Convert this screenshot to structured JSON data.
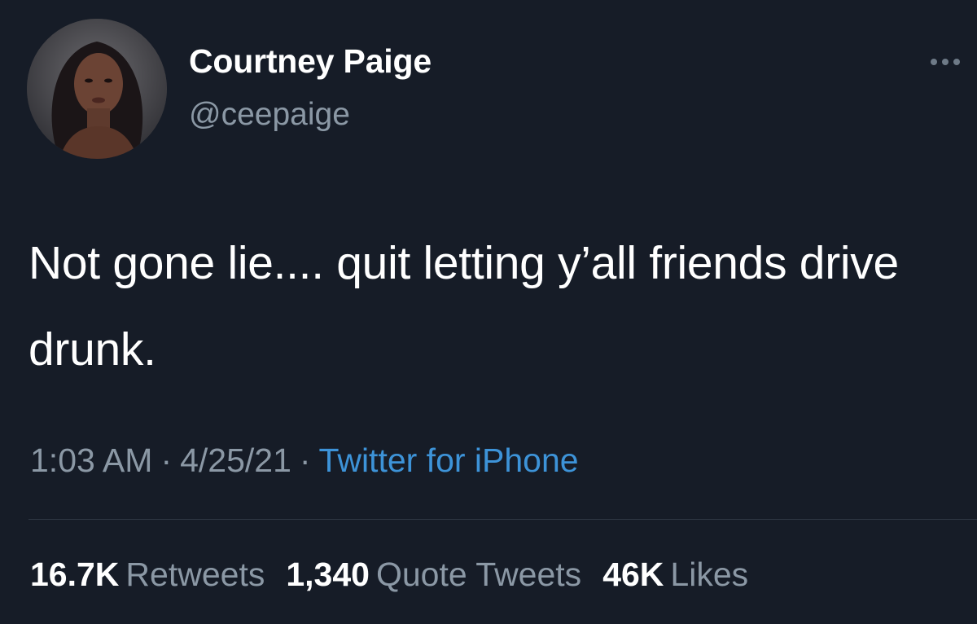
{
  "user": {
    "display_name": "Courtney Paige",
    "handle": "@ceepaige"
  },
  "tweet": {
    "text": "Not gone lie.... quit letting y’all friends drive drunk.",
    "time": "1:03 AM",
    "date": "4/25/21",
    "separator": "·",
    "source": "Twitter for iPhone"
  },
  "stats": {
    "retweets": {
      "count": "16.7K",
      "label": "Retweets"
    },
    "quote_tweets": {
      "count": "1,340",
      "label": "Quote Tweets"
    },
    "likes": {
      "count": "46K",
      "label": "Likes"
    }
  },
  "icons": {
    "more": "more-horizontal-icon",
    "avatar": "profile-photo"
  },
  "colors": {
    "background": "#161c27",
    "primary_text": "#ffffff",
    "secondary_text": "#8b98a5",
    "link": "#3d93d8",
    "divider": "#2f3844"
  }
}
